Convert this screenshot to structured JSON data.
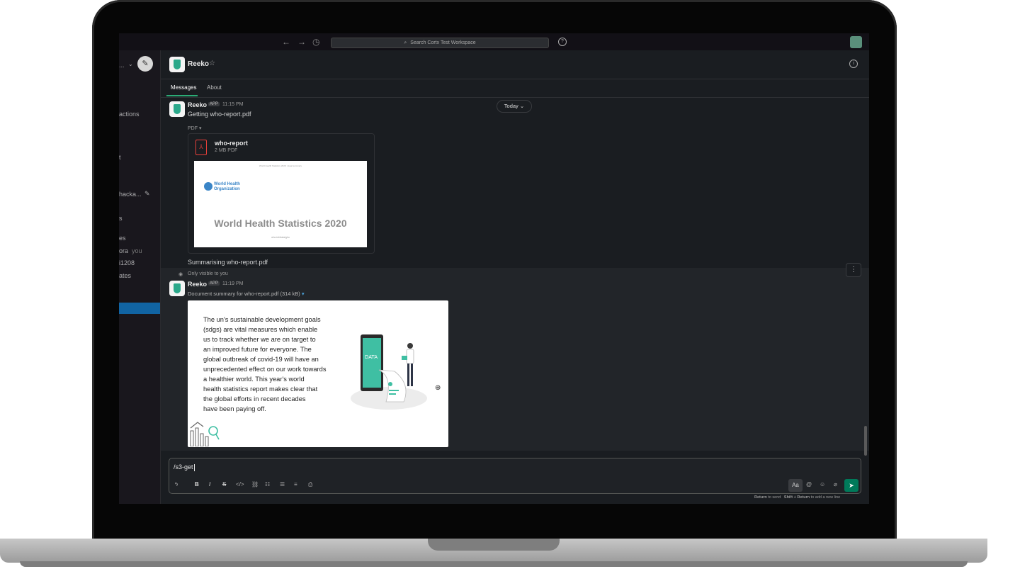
{
  "topbar": {
    "search_placeholder": "Search Cortx Test Workspace",
    "back_icon": "arrow-left-icon",
    "forward_icon": "arrow-right-icon",
    "history_icon": "clock-icon",
    "help_icon": "?"
  },
  "sidebar": {
    "workspace_suffix": "...",
    "items": [
      {
        "label": "actions"
      },
      {
        "label": "t"
      },
      {
        "label": "hacka..."
      },
      {
        "label": "s"
      },
      {
        "label": "es"
      },
      {
        "label": "ora",
        "suffix": "you"
      },
      {
        "label": "i1208"
      },
      {
        "label": "ates"
      }
    ]
  },
  "channel": {
    "name": "Reeko",
    "tabs": [
      "Messages",
      "About"
    ]
  },
  "divider": {
    "label": "Today"
  },
  "messages": [
    {
      "user": "Reeko",
      "badge": "APP",
      "time": "11:15 PM",
      "text": "Getting who-report.pdf",
      "attachment": {
        "type_label": "PDF",
        "title": "who-report",
        "subtitle": "2 MB PDF",
        "preview_header": "World Health Statistics 2020: visual summary",
        "preview_org": "World Health\nOrganization",
        "preview_title": "World Health Statistics 2020",
        "preview_footer": "who.int/data/gho"
      },
      "follow_up": "Summarising who-report.pdf"
    },
    {
      "visibility": "Only visible to you",
      "user": "Reeko",
      "badge": "APP",
      "time": "11:19 PM",
      "text": "Document summary for who-report.pdf (314 kB)",
      "summary": "The un's sustainable development goals\n(sdgs) are vital measures which enable\nus to track whether we are on target to\nan improved future for everyone.  The\nglobal outbreak of covid-19 will have an\nunprecedented effect on our work towards\na healthier world.  This year's world\nhealth statistics report makes clear that\nthe global efforts in recent decades\nhave been paying off.",
      "illustration_label": "DATA"
    }
  ],
  "composer": {
    "value": "/s3-get",
    "format_label": "Aa",
    "hint_send_key": "Return",
    "hint_send": "to send",
    "hint_newline_key": "Shift + Return",
    "hint_newline": "to add a new line"
  },
  "colors": {
    "accent_green": "#2bac76",
    "send_green": "#007a5a",
    "active_blue": "#1164a3",
    "pdf_red": "#e8403a"
  }
}
